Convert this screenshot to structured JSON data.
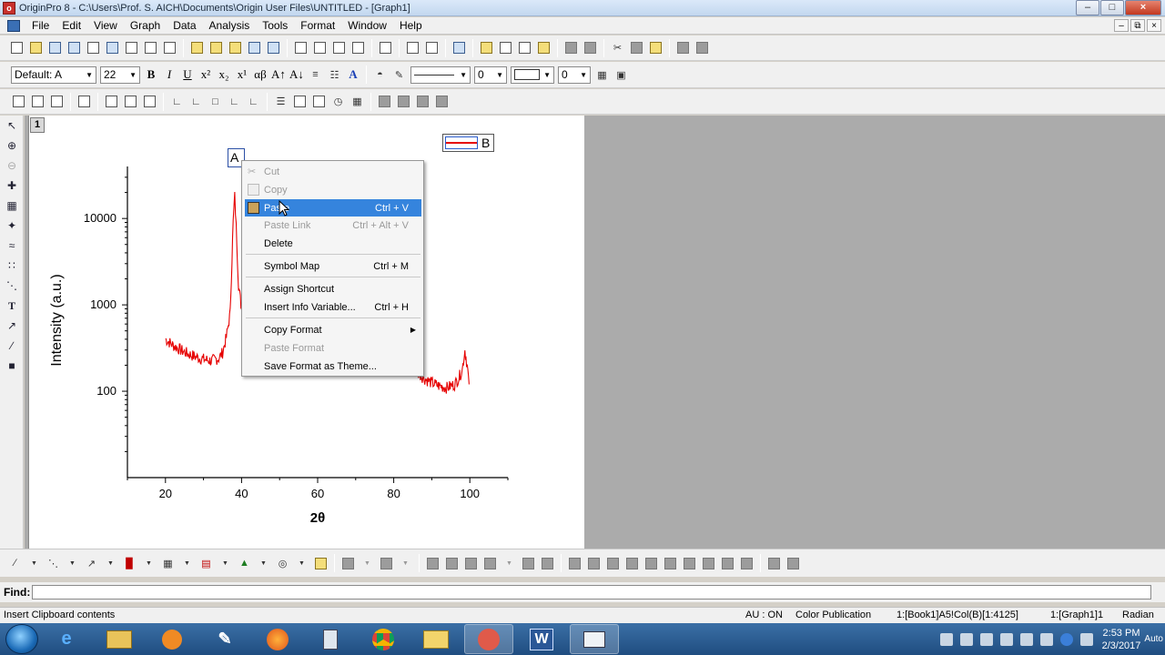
{
  "window": {
    "title": "OriginPro 8 - C:\\Users\\Prof. S. AICH\\Documents\\Origin User Files\\UNTITLED - [Graph1]"
  },
  "menu": [
    "File",
    "Edit",
    "View",
    "Graph",
    "Data",
    "Analysis",
    "Tools",
    "Format",
    "Window",
    "Help"
  ],
  "format_toolbar": {
    "font": "Default: A",
    "font_size": "22",
    "line_width": "0",
    "pattern_size": "0"
  },
  "layer_tab": "1",
  "graph": {
    "text_object": "A",
    "legend_label": "B"
  },
  "chart_data": {
    "type": "line",
    "xlabel": "2θ",
    "ylabel": "Intensity (a.u.)",
    "xlim": [
      10,
      110
    ],
    "ylim": [
      10,
      40000
    ],
    "yscale": "log",
    "xticks": [
      "20",
      "40",
      "60",
      "80",
      "100"
    ],
    "yticks": [
      "100",
      "1000",
      "10000"
    ],
    "color": "#e60000",
    "series": [
      {
        "x": [
          20,
          22,
          24,
          26,
          28,
          30,
          32,
          34,
          35,
          36,
          37,
          37.8,
          38.2,
          38.6,
          39.2,
          40,
          41,
          42,
          43,
          44,
          44.5,
          45,
          46,
          48,
          50,
          52,
          54,
          56,
          58,
          60,
          62,
          63,
          64,
          64.8,
          65.4,
          66.5,
          68,
          70,
          72,
          74,
          76,
          77.5,
          78.2,
          79,
          80,
          81.5,
          82.2,
          83,
          84,
          86,
          88,
          90,
          92,
          94,
          96,
          97,
          98,
          98.7,
          99.3,
          99.8
        ],
        "y": [
          400,
          340,
          300,
          270,
          250,
          235,
          225,
          240,
          280,
          420,
          800,
          9000,
          18000,
          8000,
          1700,
          900,
          640,
          560,
          520,
          600,
          840,
          700,
          520,
          420,
          370,
          340,
          330,
          320,
          330,
          350,
          380,
          450,
          560,
          620,
          500,
          380,
          300,
          270,
          255,
          250,
          255,
          300,
          420,
          320,
          260,
          290,
          400,
          290,
          220,
          170,
          140,
          125,
          115,
          110,
          120,
          140,
          175,
          300,
          200,
          120
        ]
      }
    ]
  },
  "context_menu": {
    "items": [
      {
        "label": "Cut",
        "shortcut": "",
        "disabled": true
      },
      {
        "label": "Copy",
        "shortcut": "",
        "disabled": true
      },
      {
        "label": "Paste",
        "shortcut": "Ctrl + V",
        "disabled": false,
        "highlighted": true
      },
      {
        "label": "Paste Link",
        "shortcut": "Ctrl + Alt + V",
        "disabled": true
      },
      {
        "label": "Delete",
        "shortcut": "",
        "disabled": false
      },
      {
        "label": "Symbol Map",
        "shortcut": "Ctrl + M",
        "disabled": false
      },
      {
        "label": "Assign Shortcut",
        "shortcut": "",
        "disabled": false
      },
      {
        "label": "Insert Info Variable...",
        "shortcut": "Ctrl + H",
        "disabled": false
      },
      {
        "label": "Copy Format",
        "shortcut": "",
        "disabled": false
      },
      {
        "label": "Paste Format",
        "shortcut": "",
        "disabled": true
      },
      {
        "label": "Save Format as Theme...",
        "shortcut": "",
        "disabled": false
      }
    ]
  },
  "find": {
    "label": "Find:",
    "value": ""
  },
  "status": {
    "hint": "Insert Clipboard contents",
    "au": "AU : ON",
    "theme": "Color Publication",
    "range": "1:[Book1]A5!Col(B)[1:4125]",
    "layer": "1:[Graph1]1",
    "angle": "Radian"
  },
  "taskbar": {
    "word_label": "W",
    "time": "2:53 PM",
    "date": "2/3/2017",
    "edge_text": "Auto"
  }
}
